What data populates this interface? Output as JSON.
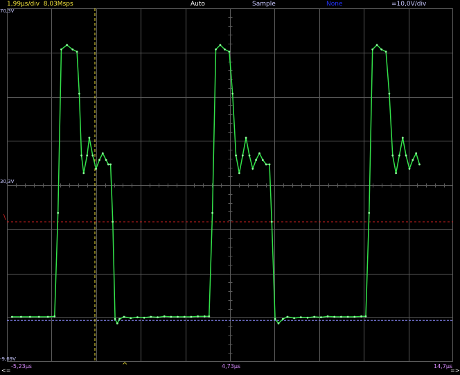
{
  "header": {
    "timebase": "1,99µs/div",
    "sample_rate": "8,03Msps",
    "trigger_mode": "Auto",
    "acquisition": "Sample",
    "filter": "None",
    "volts_per_div": "=10,0V/div"
  },
  "axis": {
    "y_top": "70,3V",
    "y_mid": "30,3V",
    "y_bottom": "-9,69V",
    "x_left": "-5,23µs",
    "x_center": "4,73µs",
    "x_right": "14,7µs",
    "left_arrow": "<=",
    "right_arrow": "=>",
    "trigger_marker": "^"
  },
  "colors": {
    "trace": "#33e24a",
    "trigger_level": "#d02020",
    "ground_ref": "#8c8cff",
    "cursor": "#f3e43c",
    "grid": "#5a5a5a"
  },
  "chart_data": {
    "type": "line",
    "title": "",
    "xlabel": "",
    "ylabel": "",
    "xlim": [
      -5.23,
      14.7
    ],
    "ylim": [
      -9.69,
      70.3
    ],
    "trigger_level": 22.0,
    "ground_level": 0.0,
    "cursor_x": -1.3,
    "series": [
      {
        "name": "",
        "x": [
          -5.0,
          -4.6,
          -4.2,
          -3.8,
          -3.4,
          -3.1,
          -2.95,
          -2.8,
          -2.55,
          -2.3,
          -2.1,
          -2.0,
          -1.9,
          -1.8,
          -1.65,
          -1.55,
          -1.4,
          -1.25,
          -1.1,
          -0.95,
          -0.8,
          -0.7,
          -0.6,
          -0.5,
          -0.4,
          -0.3,
          -0.2,
          0.0,
          0.3,
          0.6,
          0.9,
          1.2,
          1.5,
          1.8,
          2.1,
          2.4,
          2.7,
          3.0,
          3.3,
          3.6,
          3.8,
          3.95,
          4.1,
          4.3,
          4.5,
          4.7,
          4.85,
          5.0,
          5.15,
          5.3,
          5.45,
          5.6,
          5.75,
          5.9,
          6.05,
          6.2,
          6.35,
          6.5,
          6.6,
          6.75,
          6.9,
          7.1,
          7.3,
          7.6,
          7.9,
          8.2,
          8.5,
          8.8,
          9.1,
          9.4,
          9.7,
          10.0,
          10.3,
          10.6,
          10.8,
          10.95,
          11.1,
          11.3,
          11.5,
          11.7,
          11.85,
          12.0,
          12.15,
          12.3,
          12.45,
          12.6,
          12.75,
          12.9,
          13.05,
          13.2
        ],
        "y": [
          0.5,
          0.5,
          0.5,
          0.5,
          0.5,
          0.6,
          24.0,
          61.0,
          62.0,
          61.0,
          60.5,
          51.0,
          37.0,
          33.0,
          37.0,
          41.0,
          37.0,
          34.0,
          36.0,
          37.5,
          36.0,
          35.0,
          35.0,
          22.0,
          0.0,
          -1.0,
          0.0,
          0.5,
          0.2,
          0.4,
          0.3,
          0.5,
          0.4,
          0.6,
          0.5,
          0.5,
          0.5,
          0.5,
          0.6,
          0.6,
          0.6,
          24.0,
          61.0,
          62.0,
          61.0,
          60.5,
          51.0,
          37.0,
          33.0,
          37.0,
          41.0,
          37.0,
          34.0,
          36.0,
          37.5,
          36.0,
          35.0,
          35.0,
          22.0,
          0.0,
          -1.0,
          0.0,
          0.5,
          0.2,
          0.4,
          0.3,
          0.5,
          0.4,
          0.6,
          0.5,
          0.5,
          0.5,
          0.5,
          0.6,
          0.6,
          24.0,
          61.0,
          62.0,
          61.0,
          60.5,
          51.0,
          37.0,
          33.0,
          37.0,
          41.0,
          37.0,
          34.0,
          36.0,
          37.5,
          35.0
        ]
      }
    ]
  }
}
